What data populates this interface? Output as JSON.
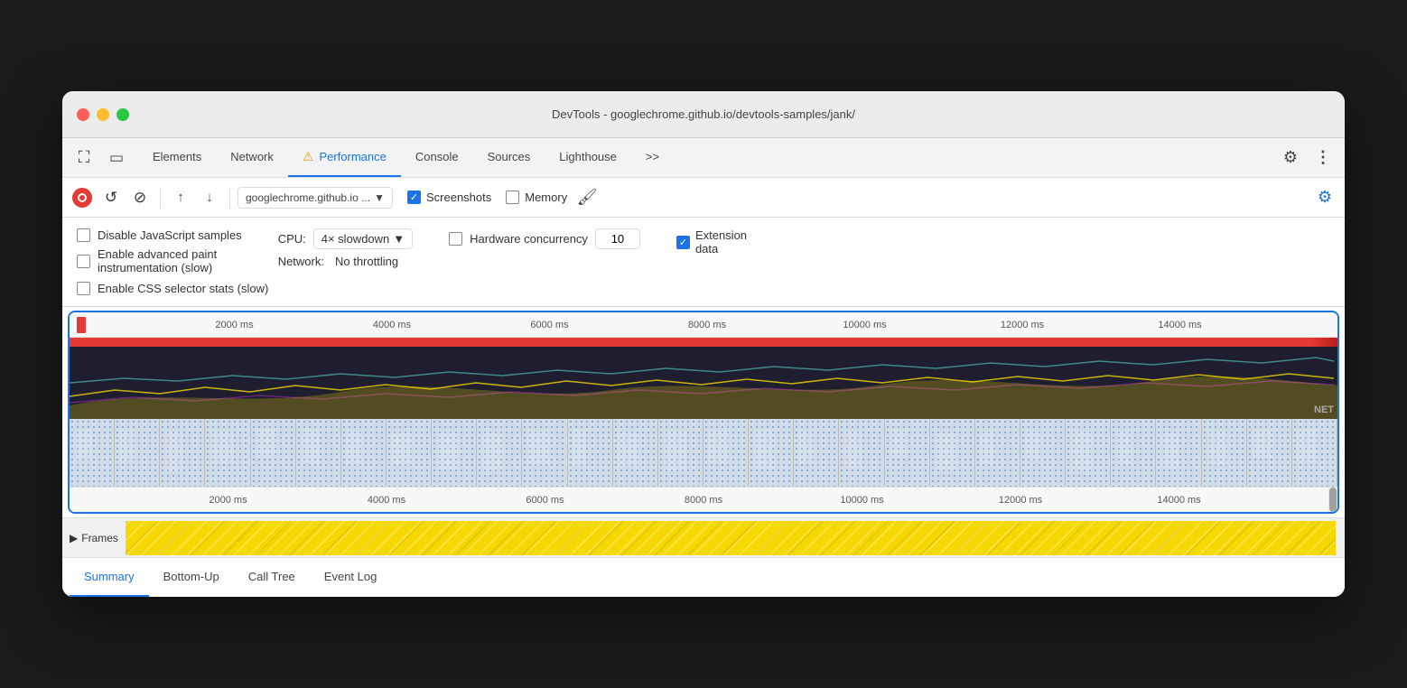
{
  "window": {
    "title": "DevTools - googlechrome.github.io/devtools-samples/jank/"
  },
  "devtools_tabs": {
    "items": [
      {
        "id": "elements",
        "label": "Elements",
        "active": false
      },
      {
        "id": "network",
        "label": "Network",
        "active": false
      },
      {
        "id": "performance",
        "label": "Performance",
        "active": true,
        "warn": true
      },
      {
        "id": "console",
        "label": "Console",
        "active": false
      },
      {
        "id": "sources",
        "label": "Sources",
        "active": false
      },
      {
        "id": "lighthouse",
        "label": "Lighthouse",
        "active": false
      },
      {
        "id": "more",
        "label": ">>",
        "active": false
      }
    ]
  },
  "toolbar": {
    "url": "googlechrome.github.io ...",
    "screenshots_label": "Screenshots",
    "memory_label": "Memory",
    "screenshots_checked": true,
    "memory_checked": false
  },
  "settings": {
    "disable_js_label": "Disable JavaScript samples",
    "disable_js_checked": false,
    "enable_paint_label": "Enable advanced paint",
    "enable_paint_label2": "instrumentation (slow)",
    "enable_paint_checked": false,
    "enable_css_label": "Enable CSS selector stats (slow)",
    "enable_css_checked": false,
    "cpu_label": "CPU:",
    "cpu_value": "4× slowdown",
    "network_label": "Network:",
    "network_value": "No throttling",
    "hw_label": "Hardware concurrency",
    "hw_value": "10",
    "hw_checked": false,
    "ext_label": "Extension",
    "ext_label2": "data",
    "ext_checked": true
  },
  "timeline": {
    "ruler_marks": [
      "2000 ms",
      "4000 ms",
      "6000 ms",
      "8000 ms",
      "10000 ms",
      "12000 ms",
      "14000 ms"
    ],
    "net_label": "NET"
  },
  "frames": {
    "label": "Frames",
    "arrow": "▶"
  },
  "bottom_tabs": {
    "items": [
      {
        "id": "summary",
        "label": "Summary",
        "active": true
      },
      {
        "id": "bottom-up",
        "label": "Bottom-Up",
        "active": false
      },
      {
        "id": "call-tree",
        "label": "Call Tree",
        "active": false
      },
      {
        "id": "event-log",
        "label": "Event Log",
        "active": false
      }
    ]
  },
  "icons": {
    "record": "⏺",
    "reload": "↺",
    "clear": "⊘",
    "upload": "↑",
    "download": "↓",
    "gear": "⚙",
    "more": "⋮",
    "inspector": "⛶",
    "device": "▭",
    "chevron": "▼",
    "triangle": "▶",
    "brush": "🖌",
    "settings_gear": "⚙"
  },
  "colors": {
    "accent": "#1a73e8",
    "red": "#e53935",
    "yellow": "#f5d800",
    "tab_active": "#1a73e8"
  }
}
